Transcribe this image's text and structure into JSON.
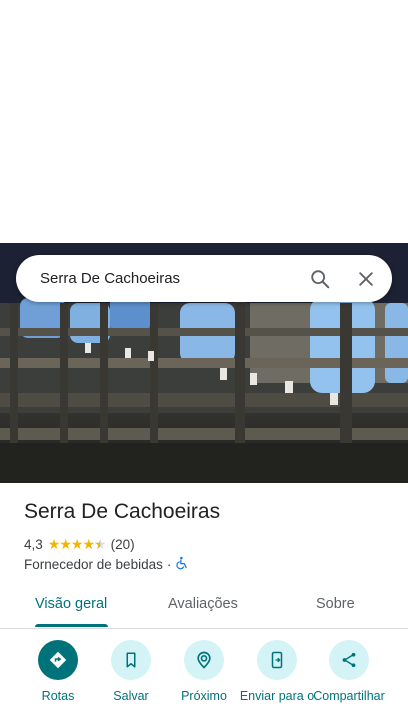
{
  "search": {
    "query": "Serra De Cachoeiras"
  },
  "place": {
    "name": "Serra De Cachoeiras",
    "rating": "4,3",
    "stars": 4.5,
    "review_count": "(20)",
    "category": "Fornecedor de bebidas",
    "separator": "·"
  },
  "tabs": [
    {
      "label": "Visão geral",
      "active": true
    },
    {
      "label": "Avaliações",
      "active": false
    },
    {
      "label": "Sobre",
      "active": false
    }
  ],
  "actions": [
    {
      "label": "Rotas",
      "icon": "directions-icon"
    },
    {
      "label": "Salvar",
      "icon": "bookmark-icon"
    },
    {
      "label": "Próximo",
      "icon": "nearby-icon"
    },
    {
      "label": "Enviar para o",
      "icon": "send-to-phone-icon"
    },
    {
      "label": "Compartilhar",
      "icon": "share-icon"
    }
  ],
  "colors": {
    "accent": "#00737a",
    "accent_light": "#d3f3f7",
    "star": "#f4b400",
    "wheelchair": "#1a73e8"
  }
}
